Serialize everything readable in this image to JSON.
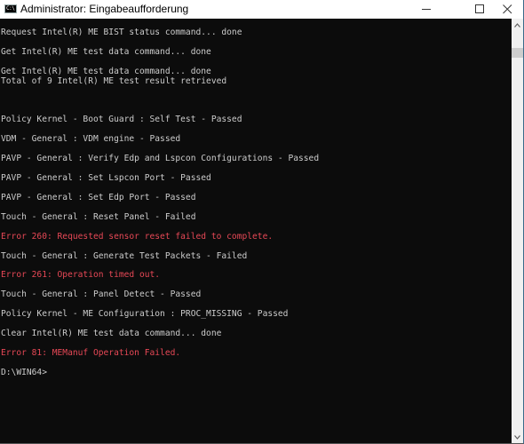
{
  "window": {
    "title": "Administrator: Eingabeaufforderung",
    "icon_label": "C:\\",
    "controls": [
      "minimize",
      "maximize",
      "close"
    ]
  },
  "colors": {
    "console_bg": "#0c0c0c",
    "text": "#cccccc",
    "error": "#e74856"
  },
  "console": {
    "lines": [
      {
        "text": "Request Intel(R) ME BIST status command... done",
        "type": "normal"
      },
      {
        "text": "",
        "type": "normal"
      },
      {
        "text": "Get Intel(R) ME test data command... done",
        "type": "normal"
      },
      {
        "text": "",
        "type": "normal"
      },
      {
        "text": "Get Intel(R) ME test data command... done",
        "type": "normal"
      },
      {
        "text": "Total of 9 Intel(R) ME test result retrieved",
        "type": "normal"
      },
      {
        "text": "",
        "type": "normal"
      },
      {
        "text": "",
        "type": "normal"
      },
      {
        "text": "",
        "type": "normal"
      },
      {
        "text": "Policy Kernel - Boot Guard : Self Test - Passed",
        "type": "normal"
      },
      {
        "text": "",
        "type": "normal"
      },
      {
        "text": "VDM - General : VDM engine - Passed",
        "type": "normal"
      },
      {
        "text": "",
        "type": "normal"
      },
      {
        "text": "PAVP - General : Verify Edp and Lspcon Configurations - Passed",
        "type": "normal"
      },
      {
        "text": "",
        "type": "normal"
      },
      {
        "text": "PAVP - General : Set Lspcon Port - Passed",
        "type": "normal"
      },
      {
        "text": "",
        "type": "normal"
      },
      {
        "text": "PAVP - General : Set Edp Port - Passed",
        "type": "normal"
      },
      {
        "text": "",
        "type": "normal"
      },
      {
        "text": "Touch - General : Reset Panel - Failed",
        "type": "normal"
      },
      {
        "text": "",
        "type": "normal"
      },
      {
        "text": "Error 260: Requested sensor reset failed to complete.",
        "type": "err"
      },
      {
        "text": "",
        "type": "normal"
      },
      {
        "text": "Touch - General : Generate Test Packets - Failed",
        "type": "normal"
      },
      {
        "text": "",
        "type": "normal"
      },
      {
        "text": "Error 261: Operation timed out.",
        "type": "err"
      },
      {
        "text": "",
        "type": "normal"
      },
      {
        "text": "Touch - General : Panel Detect - Passed",
        "type": "normal"
      },
      {
        "text": "",
        "type": "normal"
      },
      {
        "text": "Policy Kernel - ME Configuration : PROC_MISSING - Passed",
        "type": "normal"
      },
      {
        "text": "",
        "type": "normal"
      },
      {
        "text": "Clear Intel(R) ME test data command... done",
        "type": "normal"
      },
      {
        "text": "",
        "type": "normal"
      },
      {
        "text": "Error 81: MEManuf Operation Failed.",
        "type": "err"
      },
      {
        "text": "",
        "type": "normal"
      },
      {
        "text": "D:\\WIN64>",
        "type": "normal"
      }
    ]
  }
}
